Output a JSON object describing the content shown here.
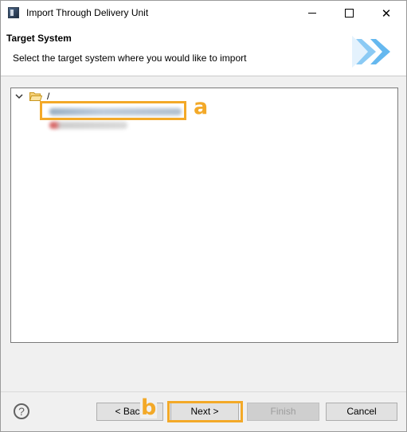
{
  "window": {
    "title": "Import Through Delivery Unit",
    "controls": {
      "minimize": "—",
      "maximize": "",
      "close": "✕"
    }
  },
  "banner": {
    "title": "Target System",
    "description": "Select the target system where you would like to import",
    "graphic_icon": "forward-chevrons-graphic"
  },
  "tree": {
    "root_label": "/",
    "root_expanded": true,
    "root_icon": "open-folder-icon",
    "items": [
      {
        "label": "",
        "blurred": true,
        "selected": true
      },
      {
        "label": "",
        "blurred": true,
        "selected": false
      }
    ]
  },
  "annotations": {
    "a": "a",
    "b": "b"
  },
  "buttons": {
    "help": "?",
    "back": "< Back",
    "next": "Next >",
    "finish": "Finish",
    "cancel": "Cancel",
    "finish_enabled": false
  },
  "colors": {
    "highlight": "#f3a928",
    "banner_accent": "#65b8ef"
  }
}
